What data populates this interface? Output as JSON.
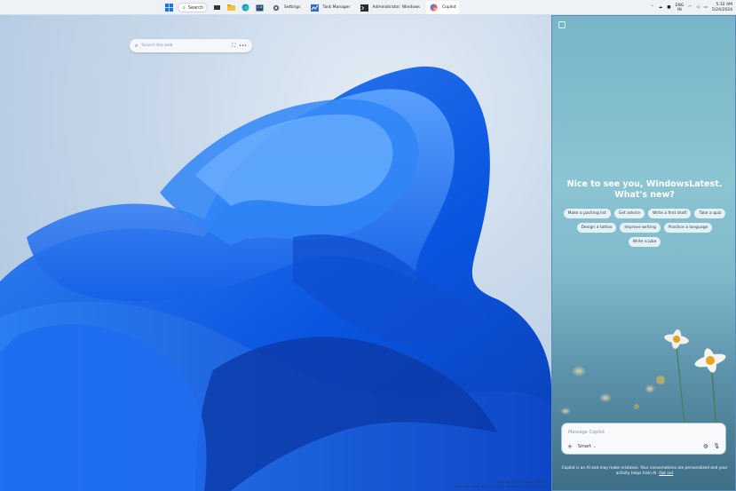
{
  "taskbar": {
    "search_label": "Search",
    "apps": [
      {
        "label": "Settings",
        "icon": "settings-icon"
      },
      {
        "label": "Task Manager",
        "icon": "task-manager-icon"
      },
      {
        "label": "Administrator: Windows",
        "icon": "terminal-icon"
      },
      {
        "label": "Copilot",
        "icon": "copilot-icon"
      }
    ],
    "lang_top": "ENG",
    "lang_bottom": "IN",
    "time": "5:32 AM",
    "date": "5/24/2024"
  },
  "desktop": {
    "wall_search_placeholder": "Search the web",
    "more_label": "•••",
    "watermark_line1": "Windows 11 Pro Insider Preview",
    "watermark_line2": "Evaluation copy. Build 26100.ge_release_svc.240405-1412"
  },
  "copilot": {
    "greeting": "Nice to see you, WindowsLatest. What's new?",
    "chips_row1": [
      "Make a packing list",
      "Get advice",
      "Write a first draft",
      "Take a quiz"
    ],
    "chips_row2": [
      "Design a tattoo",
      "Improve writing",
      "Practice a language"
    ],
    "chips_row3": [
      "Write a joke"
    ],
    "message_placeholder": "Message Copilot",
    "mode_label": "Smart",
    "disclaimer": "Copilot is an AI and may make mistakes. Your conversations are personalized and your activity helps train AI.",
    "opt_out_label": "Opt out"
  },
  "colors": {
    "accent": "#1a5fe0",
    "panel_top": "#77b5c8",
    "panel_bottom": "#3e6e86"
  }
}
